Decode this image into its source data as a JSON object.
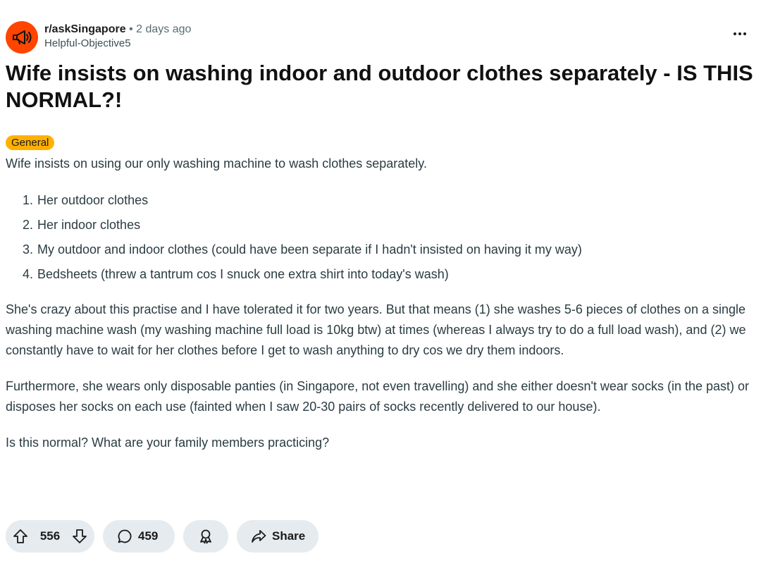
{
  "header": {
    "subreddit": "r/askSingapore",
    "separator": "•",
    "time": "2 days ago",
    "author": "Helpful-Objective5",
    "avatar_icon": "megaphone-icon",
    "more_icon": "more-options-icon"
  },
  "post": {
    "title": "Wife insists on washing indoor and outdoor clothes separately - IS THIS NORMAL?!",
    "flair": "General",
    "intro": "Wife insists on using our only washing machine to wash clothes separately.",
    "list": [
      {
        "num": "1.",
        "text": "Her outdoor clothes"
      },
      {
        "num": "2.",
        "text": "Her indoor clothes"
      },
      {
        "num": "3.",
        "text": "My outdoor and indoor clothes (could have been separate if I hadn't insisted on having it my way)"
      },
      {
        "num": "4.",
        "text": "Bedsheets (threw a tantrum cos I snuck one extra shirt into today's wash)"
      }
    ],
    "paragraphs": [
      "She's crazy about this practise and I have tolerated it for two years. But that means (1) she washes 5-6 pieces of clothes on a single washing machine wash (my washing machine full load is 10kg btw) at times (whereas I always try to do a full load wash), and (2) we constantly have to wait for her clothes before I get to wash anything to dry cos we dry them indoors.",
      "Furthermore, she wears only disposable panties (in Singapore, not even travelling) and she either doesn't wear socks (in the past) or disposes her socks on each use (fainted when I saw 20-30 pairs of socks recently delivered to our house).",
      "Is this normal? What are your family members practicing?"
    ]
  },
  "actions": {
    "upvote_icon": "upvote-arrow-icon",
    "score": "556",
    "downvote_icon": "downvote-arrow-icon",
    "comment_icon": "comment-bubble-icon",
    "comments": "459",
    "award_icon": "award-icon",
    "share_icon": "share-arrow-icon",
    "share_label": "Share"
  },
  "colors": {
    "avatar": "#ff4500",
    "flair": "#ffb000",
    "pill_background": "#e5ebee",
    "meta_text": "#576f76"
  }
}
